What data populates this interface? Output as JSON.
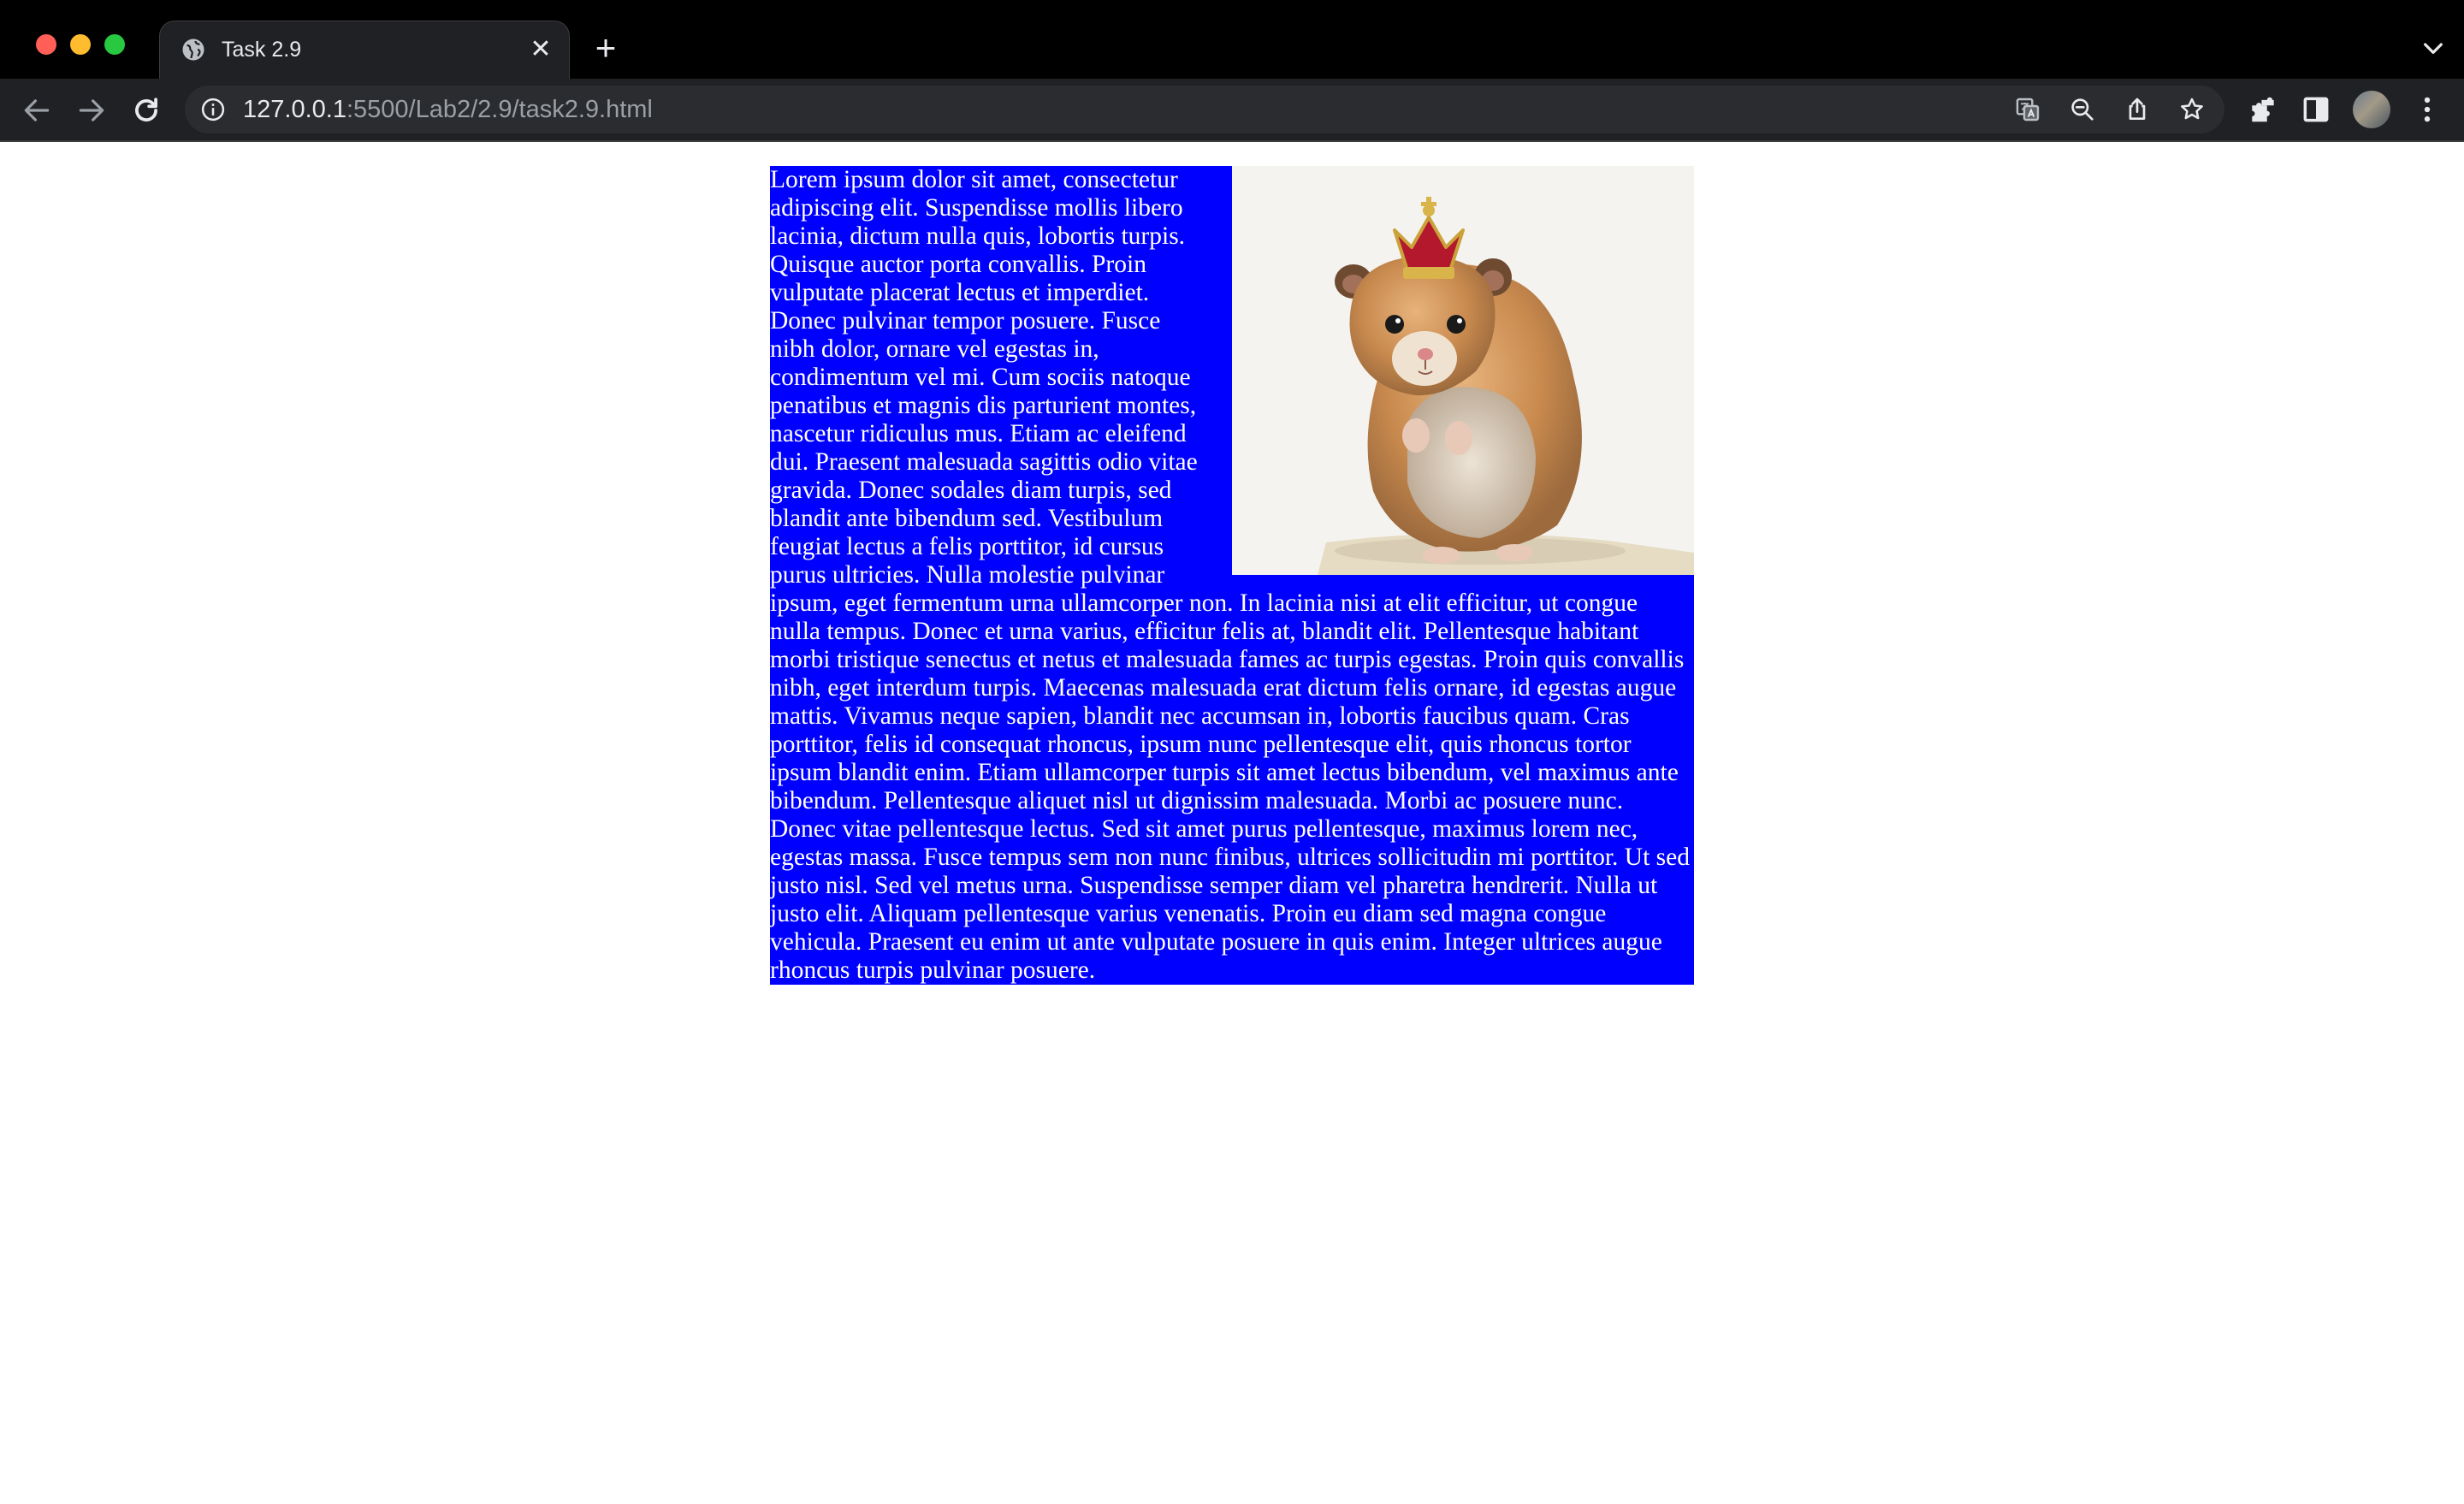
{
  "browser": {
    "tab": {
      "title": "Task 2.9"
    },
    "address_bar": {
      "host": "127.0.0.1",
      "path": ":5500/Lab2/2.9/task2.9.html"
    }
  },
  "page": {
    "image": {
      "alt": "Hamster wearing a crown"
    },
    "paragraph": "Lorem ipsum dolor sit amet, consectetur adipiscing elit. Suspendisse mollis libero lacinia, dictum nulla quis, lobortis turpis. Quisque auctor porta convallis. Proin vulputate placerat lectus et imperdiet. Donec pulvinar tempor posuere. Fusce nibh dolor, ornare vel egestas in, condimentum vel mi. Cum sociis natoque penatibus et magnis dis parturient montes, nascetur ridiculus mus. Etiam ac eleifend dui. Praesent malesuada sagittis odio vitae gravida. Donec sodales diam turpis, sed blandit ante bibendum sed. Vestibulum feugiat lectus a felis porttitor, id cursus purus ultricies. Nulla molestie pulvinar ipsum, eget fermentum urna ullamcorper non. In lacinia nisi at elit efficitur, ut congue nulla tempus. Donec et urna varius, efficitur felis at, blandit elit. Pellentesque habitant morbi tristique senectus et netus et malesuada fames ac turpis egestas. Proin quis convallis nibh, eget interdum turpis. Maecenas malesuada erat dictum felis ornare, id egestas augue mattis. Vivamus neque sapien, blandit nec accumsan in, lobortis faucibus quam. Cras porttitor, felis id consequat rhoncus, ipsum nunc pellentesque elit, quis rhoncus tortor ipsum blandit enim. Etiam ullamcorper turpis sit amet lectus bibendum, vel maximus ante bibendum. Pellentesque aliquet nisl ut dignissim malesuada. Morbi ac posuere nunc. Donec vitae pellentesque lectus. Sed sit amet purus pellentesque, maximus lorem nec, egestas massa. Fusce tempus sem non nunc finibus, ultrices sollicitudin mi porttitor. Ut sed justo nisl. Sed vel metus urna. Suspendisse semper diam vel pharetra hendrerit. Nulla ut justo elit. Aliquam pellentesque varius venenatis. Proin eu diam sed magna congue vehicula. Praesent eu enim ut ante vulputate posuere in quis enim. Integer ultrices augue rhoncus turpis pulvinar posuere."
  },
  "colors": {
    "content_background": "#0000ff",
    "content_text": "#ffffff",
    "chrome_frame": "#000000",
    "toolbar": "#202124"
  }
}
